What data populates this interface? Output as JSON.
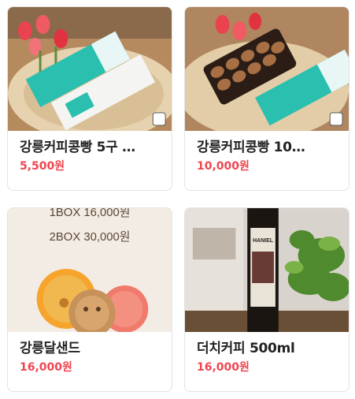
{
  "products": [
    {
      "title": "강릉커피콩빵 5구 …",
      "price": "5,500원",
      "image_alt": "coffee-bean-bread-5-box-image"
    },
    {
      "title": "강릉커피콩빵 10…",
      "price": "10,000원",
      "image_alt": "coffee-bean-bread-10-box-image"
    },
    {
      "title": "강릉달샌드",
      "price": "16,000원",
      "image_alt": "gangneung-dal-sand-image",
      "image_text": [
        "1BOX 16,000원",
        "2BOX 30,000원"
      ]
    },
    {
      "title": "더치커피 500ml",
      "price": "16,000원",
      "image_alt": "dutch-coffee-bottle-image",
      "image_text": [
        "HANIEL"
      ]
    }
  ],
  "colors": {
    "price": "#f0454e",
    "box_teal": "#2bbfb0",
    "card_border": "#e3e3e3"
  }
}
